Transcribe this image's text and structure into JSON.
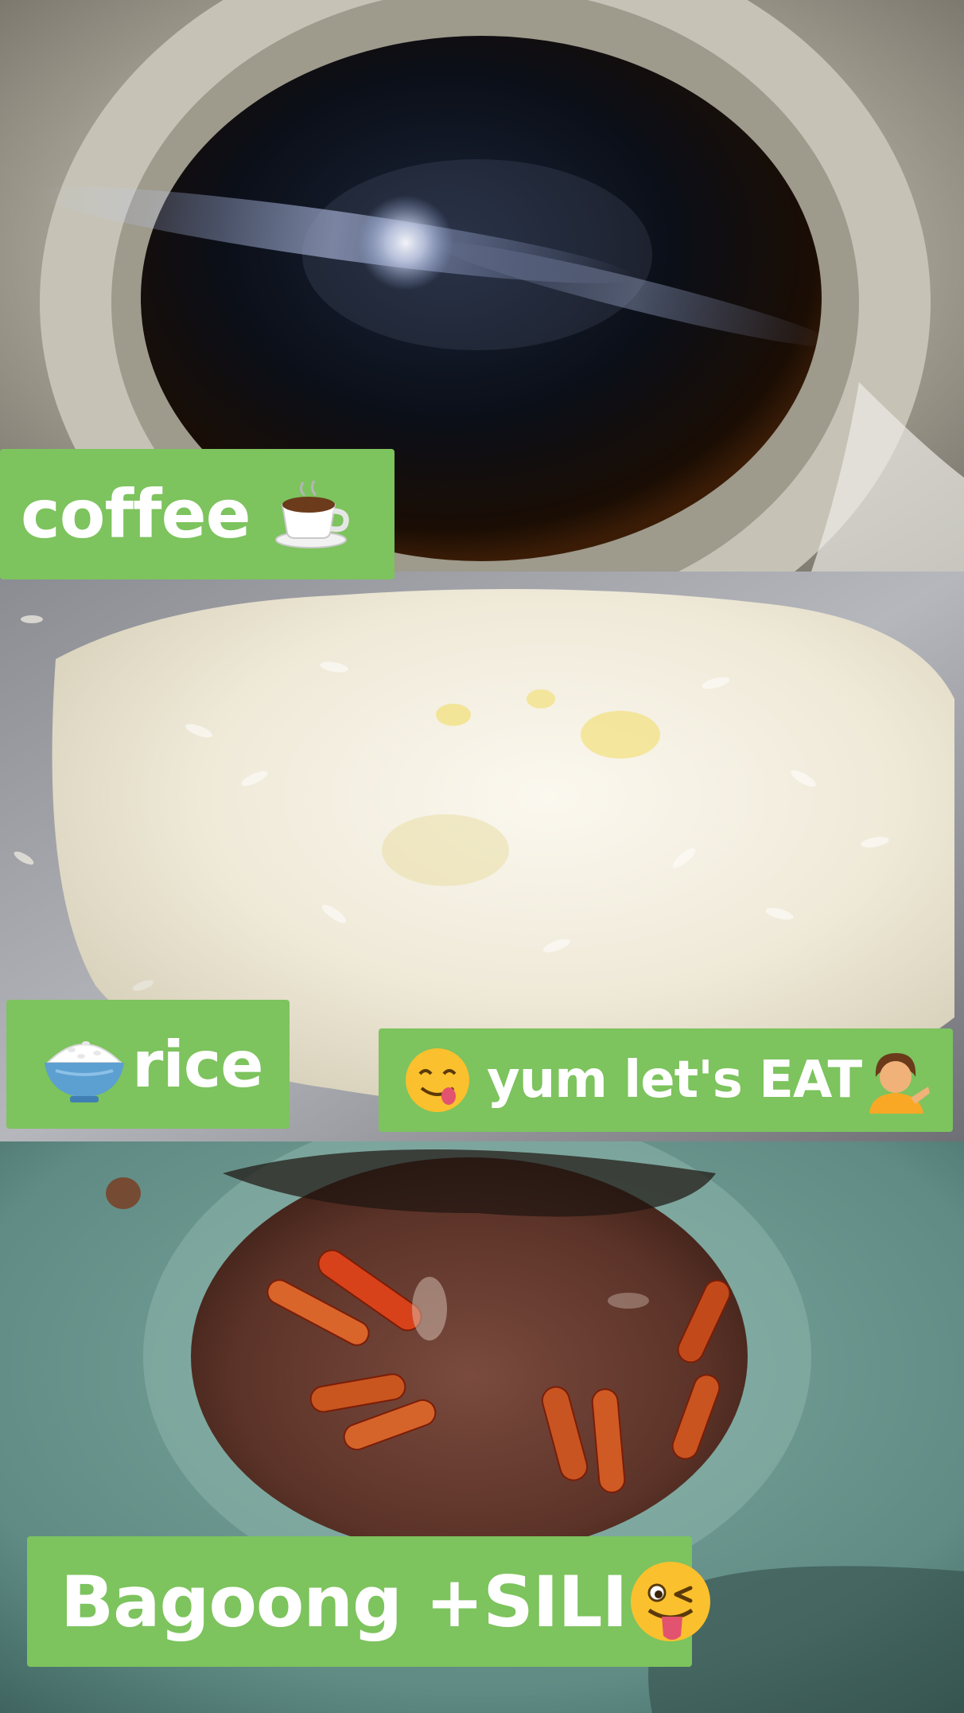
{
  "captions": {
    "coffee": {
      "text": "coffee",
      "emoji": "coffee-cup-icon"
    },
    "rice": {
      "text": "rice",
      "emoji": "rice-bowl-icon"
    },
    "yum": {
      "text": "yum let's EAT",
      "emoji_before": "savoring-face-icon",
      "emoji_after": "person-tipping-hand-icon"
    },
    "bagoong": {
      "text": "Bagoong +SILI",
      "emoji": "winking-tongue-face-icon"
    }
  },
  "colors": {
    "caption_background": "#7dc35e",
    "caption_text": "#ffffff"
  },
  "photos": [
    "black coffee in a mug",
    "white rice",
    "bagoong with red chili peppers"
  ]
}
